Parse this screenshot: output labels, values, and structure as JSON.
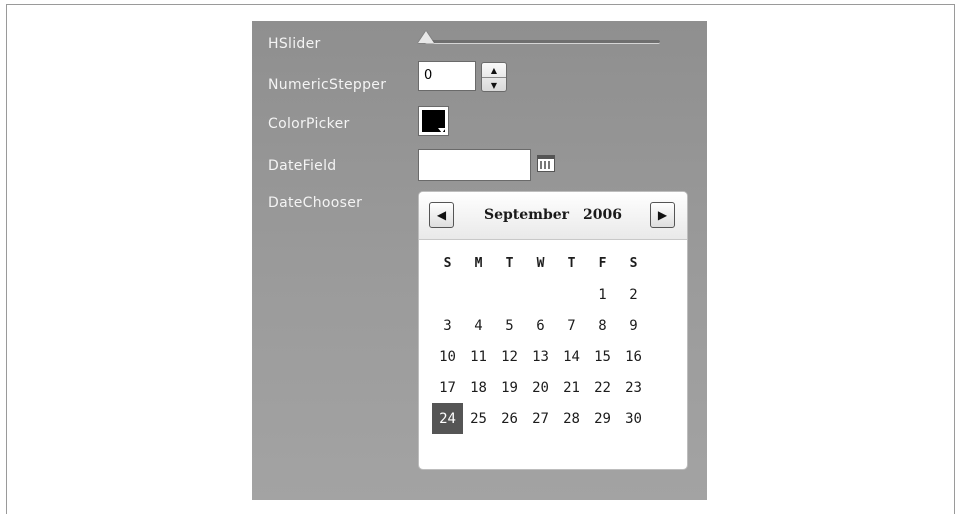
{
  "labels": {
    "hslider": "HSlider",
    "numeric_stepper": "NumericStepper",
    "color_picker": "ColorPicker",
    "date_field": "DateField",
    "date_chooser": "DateChooser"
  },
  "hslider": {
    "value_fraction": 0
  },
  "numeric_stepper": {
    "value": "0"
  },
  "color_picker": {
    "color": "#000000"
  },
  "date_field": {
    "value": ""
  },
  "date_chooser": {
    "month": "September",
    "year": "2006",
    "weekdays": [
      "S",
      "M",
      "T",
      "W",
      "T",
      "F",
      "S"
    ],
    "weeks": [
      [
        "",
        "",
        "",
        "",
        "",
        "1",
        "2"
      ],
      [
        "3",
        "4",
        "5",
        "6",
        "7",
        "8",
        "9"
      ],
      [
        "10",
        "11",
        "12",
        "13",
        "14",
        "15",
        "16"
      ],
      [
        "17",
        "18",
        "19",
        "20",
        "21",
        "22",
        "23"
      ],
      [
        "24",
        "25",
        "26",
        "27",
        "28",
        "29",
        "30"
      ]
    ],
    "selected_day": "24"
  },
  "icons": {
    "prev": "left-arrow-icon",
    "next": "right-arrow-icon",
    "calendar": "calendar-icon"
  }
}
